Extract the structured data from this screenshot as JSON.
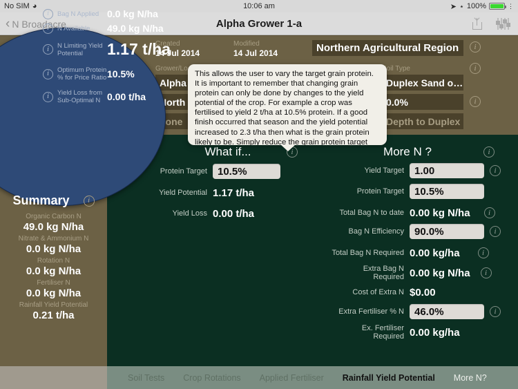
{
  "statusbar": {
    "carrier": "No SIM",
    "wifi_icon": "wifi-icon",
    "time": "10:06 am",
    "location_icon": "location-arrow-icon",
    "bluetooth_icon": "bluetooth-icon",
    "battery_percent": "100%"
  },
  "navbar": {
    "back_label": "N Broadacre",
    "title": "Alpha Grower 1-a",
    "share_icon": "share-icon",
    "settings_icon": "sliders-icon"
  },
  "circle": {
    "rows": [
      {
        "label": "Bag N Applied",
        "value": "0.0 kg N/ha",
        "big": false
      },
      {
        "label": "N Available",
        "value": "49.0 kg N/ha",
        "big": false
      },
      {
        "label": "N Limiting Yield Potential",
        "value": "1.17 t/ha",
        "big": true
      },
      {
        "label": "Optimum Protein % for Price Ratio",
        "value": "10.5%",
        "big": false
      },
      {
        "label": "Yield Loss from Sub-Optimal N",
        "value": "0.00 t/ha",
        "big": false
      }
    ]
  },
  "summary": {
    "title": "Summary",
    "items": [
      {
        "label": "Organic Carbon N",
        "value": "49.0 kg N/ha"
      },
      {
        "label": "Nitrate & Ammonium N",
        "value": "0.0 kg N/ha"
      },
      {
        "label": "Rotation N",
        "value": "0.0 kg N/ha"
      },
      {
        "label": "Fertiliser N",
        "value": "0.0 kg N/ha"
      },
      {
        "label": "Rainfall Yield Potential",
        "value": "0.21 t/ha"
      }
    ]
  },
  "top_panel": {
    "created_label": "Created",
    "created_value": "14 Jul 2014",
    "modified_label": "Modified",
    "modified_value": "14 Jul 2014",
    "region_value": "Northern Agricultural Region",
    "grower_label": "Grower/Lo",
    "soil_type_label": "Soil Type",
    "grower_value": "Alpha G",
    "paddock_value": "North Pa",
    "zone_value": "Zone",
    "soil_value": "Duplex Sand o…",
    "percent_value": "0.0%",
    "depth_value": "Depth to Duplex"
  },
  "tooltip": {
    "text": "This allows the user to vary the target grain protein. It is important to remember that changing grain protein can only be done by changes to the yield potential of the crop. For example a crop was fertilised to yield 2 t/ha at 10.5% protein. If a good finish occurred that season and the yield potential increased to 2.3 t/ha then what is the grain protein likely to be. Simply reduce the grain protein target until the yield is achieved. Of course delivering wheat with"
  },
  "what_if": {
    "title": "What if...",
    "rows": [
      {
        "label": "Protein Target",
        "value": "10.5%",
        "input": true
      },
      {
        "label": "Yield Potential",
        "value": "1.17 t/ha",
        "input": false
      },
      {
        "label": "Yield Loss",
        "value": "0.00 t/ha",
        "input": false
      }
    ]
  },
  "more_n": {
    "title": "More N ?",
    "rows": [
      {
        "label": "Yield Target",
        "value": "1.00",
        "input": true,
        "info": true
      },
      {
        "label": "Protein Target",
        "value": "10.5%",
        "input": true,
        "info": false
      },
      {
        "label": "Total Bag N to date",
        "value": "0.00 kg N/ha",
        "input": false,
        "info": true
      },
      {
        "label": "Bag N Efficiency",
        "value": "90.0%",
        "input": true,
        "info": true
      },
      {
        "label": "Total Bag N Required",
        "value": "0.00 kg/ha",
        "input": false,
        "info": true
      },
      {
        "label": "Extra Bag N Required",
        "value": "0.00 kg N/ha",
        "input": false,
        "info": true
      },
      {
        "label": "Cost of Extra N",
        "value": "$0.00",
        "input": false,
        "info": false
      },
      {
        "label": "Extra Fertiliser % N",
        "value": "46.0%",
        "input": true,
        "info": true
      },
      {
        "label": "Ex. Fertiliser Required",
        "value": "0.00 kg/ha",
        "input": false,
        "info": false
      }
    ]
  },
  "tabbar": {
    "tabs": [
      {
        "label": "Soil Tests",
        "state": "inactive"
      },
      {
        "label": "Crop Rotations",
        "state": "inactive"
      },
      {
        "label": "Applied Fertiliser",
        "state": "inactive"
      },
      {
        "label": "Rainfall Yield Potential",
        "state": "active"
      },
      {
        "label": "More N?",
        "state": "light"
      }
    ]
  },
  "colors": {
    "circle_blue": "#2e4a77",
    "panel_green": "#0b2f22",
    "panel_tan": "#6c6145",
    "field_brown": "#4a412b"
  }
}
